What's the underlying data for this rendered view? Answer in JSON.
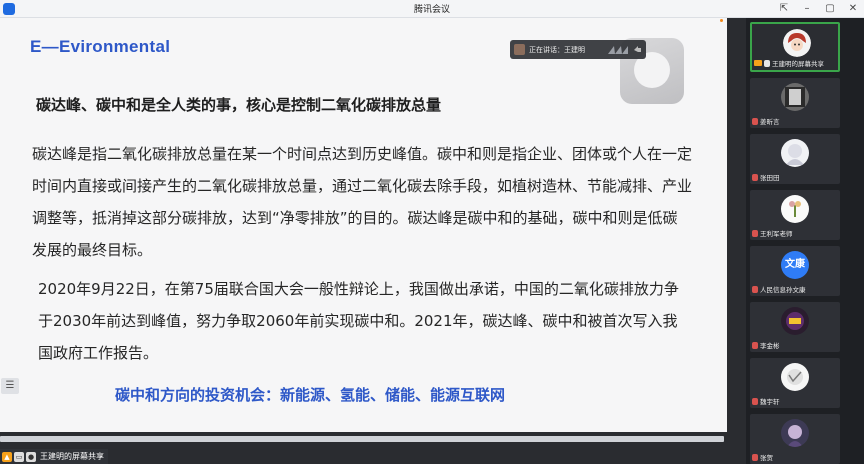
{
  "window": {
    "title": "腾讯会议",
    "controls": [
      "⇱",
      "–",
      "▢",
      "✕"
    ]
  },
  "slide": {
    "heading": "E—Evironmental",
    "subhead": "碳达峰、碳中和是全人类的事，核心是控制二氧化碳排放总量",
    "para1": "碳达峰是指二氧化碳排放总量在某一个时间点达到历史峰值。碳中和则是指企业、团体或个人在一定时间内直接或间接产生的二氧化碳排放总量，通过二氧化碳去除手段，如植树造林、节能减排、产业调整等，抵消掉这部分碳排放，达到“净零排放”的目的。碳达峰是碳中和的基础，碳中和则是低碳发展的最终目标。",
    "para2": "2020年9月22日，在第75届联合国大会一般性辩论上，我国做出承诺，中国的二氧化碳排放力争于2030年前达到峰值，努力争取2060年前实现碳中和。2021年，碳达峰、碳中和被首次写入我国政府工作报告。",
    "callout": "碳中和方向的投资机会：新能源、氢能、储能、能源互联网"
  },
  "speaking": {
    "label": "正在讲话：王建明"
  },
  "share_bar": {
    "label": "王建明的屏幕共享"
  },
  "participants": [
    {
      "name": "王建明的屏幕共享",
      "avatar": "cartoon-girl-avatar",
      "active": true
    },
    {
      "name": "姜昕言",
      "avatar": "photo-avatar"
    },
    {
      "name": "张田田",
      "avatar": "photo-avatar"
    },
    {
      "name": "王利军老师",
      "avatar": "photo-avatar"
    },
    {
      "name": "人民信息孙文康",
      "avatar": "text-avatar",
      "avatar_text": "文康"
    },
    {
      "name": "李金彬",
      "avatar": "photo-avatar"
    },
    {
      "name": "魏宇轩",
      "avatar": "photo-avatar"
    },
    {
      "name": "张贺",
      "avatar": "photo-avatar"
    }
  ],
  "colors": {
    "accent_blue": "#2e58c8",
    "active_green": "#3aa54a",
    "text_avatar_bg": "#2f7cf6"
  }
}
